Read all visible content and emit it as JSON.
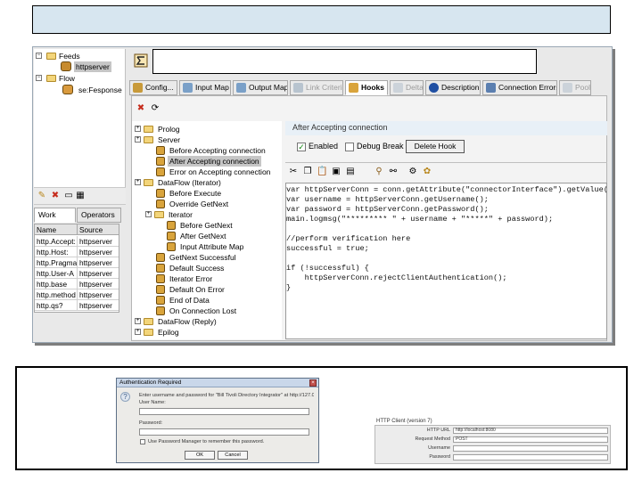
{
  "colors": {
    "title_band": "#d7e6f0",
    "selection": "#c6c6c6",
    "hook_header": "#e8f0f7"
  },
  "nav_tree": {
    "items": [
      {
        "label": "Feeds",
        "icon": "folder-icon"
      },
      {
        "label": "httpserver",
        "icon": "feed-node-icon"
      },
      {
        "label": "Flow",
        "icon": "folder-icon"
      },
      {
        "label": "se:Fesponse",
        "icon": "flow-node-icon"
      }
    ]
  },
  "side_panel": {
    "tabs": [
      "Work Entry",
      "Operators"
    ],
    "columns": [
      "Name",
      "Source"
    ],
    "rows": [
      [
        "http.Accept:",
        "httpserver"
      ],
      [
        "http.Host:",
        "httpserver"
      ],
      [
        "http.Pragma",
        "httpserver"
      ],
      [
        "http.User-A",
        "httpserver"
      ],
      [
        "http.base",
        "httpserver"
      ],
      [
        "http.method",
        "httpserver"
      ],
      [
        "http.qs?",
        "httpserver"
      ]
    ]
  },
  "tabs": [
    {
      "label": "Config...",
      "icon": "config-icon",
      "state": "normal"
    },
    {
      "label": "Input Map",
      "icon": "input-map-icon",
      "state": "normal"
    },
    {
      "label": "Output Map",
      "icon": "output-map-icon",
      "state": "normal"
    },
    {
      "label": "Link Criteria",
      "icon": "link-criteria-icon",
      "state": "dim"
    },
    {
      "label": "Hooks",
      "icon": "hooks-icon",
      "state": "active"
    },
    {
      "label": "Delta",
      "icon": "delta-icon",
      "state": "dim"
    },
    {
      "label": "Description",
      "icon": "info-icon",
      "state": "normal"
    },
    {
      "label": "Connection Errors",
      "icon": "connection-errors-icon",
      "state": "normal"
    },
    {
      "label": "Pool",
      "icon": "pool-icon",
      "state": "dim"
    }
  ],
  "hooks_tree": {
    "items": [
      {
        "label": "Prolog",
        "level": 0,
        "kind": "folder"
      },
      {
        "label": "Server",
        "level": 0,
        "kind": "folder"
      },
      {
        "label": "Before Accepting connection",
        "level": 1,
        "kind": "hook"
      },
      {
        "label": "After Accepting connection",
        "level": 1,
        "kind": "hook",
        "selected": true
      },
      {
        "label": "Error on Accepting connection",
        "level": 1,
        "kind": "hook"
      },
      {
        "label": "DataFlow (Iterator)",
        "level": 0,
        "kind": "folder"
      },
      {
        "label": "Before Execute",
        "level": 1,
        "kind": "hook"
      },
      {
        "label": "Override GetNext",
        "level": 1,
        "kind": "hook"
      },
      {
        "label": "Iterator",
        "level": 1,
        "kind": "folder"
      },
      {
        "label": "Before GetNext",
        "level": 2,
        "kind": "hook"
      },
      {
        "label": "After GetNext",
        "level": 2,
        "kind": "hook"
      },
      {
        "label": "Input Attribute Map",
        "level": 2,
        "kind": "hook"
      },
      {
        "label": "GetNext Successful",
        "level": 1,
        "kind": "hook"
      },
      {
        "label": "Default Success",
        "level": 1,
        "kind": "hook"
      },
      {
        "label": "Iterator Error",
        "level": 1,
        "kind": "hook"
      },
      {
        "label": "Default On Error",
        "level": 1,
        "kind": "hook"
      },
      {
        "label": "End of Data",
        "level": 1,
        "kind": "hook"
      },
      {
        "label": "On Connection Lost",
        "level": 1,
        "kind": "hook"
      },
      {
        "label": "DataFlow (Reply)",
        "level": 0,
        "kind": "folder"
      },
      {
        "label": "Epilog",
        "level": 0,
        "kind": "folder"
      }
    ]
  },
  "hook_panel": {
    "title": "After Accepting connection",
    "enabled_label": "Enabled",
    "debug_label": "Debug Break",
    "delete_label": "Delete Hook",
    "code": [
      "var httpServerConn = conn.getAttribute(\"connectorInterface\").getValue(0);",
      "var username = httpServerConn.getUsername();",
      "var password = httpServerConn.getPassword();",
      "main.logmsg(\"********* \" + username + \"*****\" + password);",
      "",
      "//perform verification here",
      "successful = true;",
      "",
      "if (!successful) {",
      "    httpServerConn.rejectClientAuthentication();",
      "}"
    ]
  },
  "auth_dialog": {
    "title": "Authentication Required",
    "message": "Enter username and password for \"Bill Tivoli Directory Integrator\" at http://127.0.0.1",
    "username_label": "User Name:",
    "password_label": "Password:",
    "remember_label": "Use Password Manager to remember this password.",
    "ok_label": "OK",
    "cancel_label": "Cancel"
  },
  "http_client": {
    "title": "HTTP Client (version 7)",
    "fields": [
      {
        "label": "HTTP URL",
        "value": "http://localhost:8080"
      },
      {
        "label": "Request Method",
        "value": "POST"
      },
      {
        "label": "Username",
        "value": ""
      },
      {
        "label": "Password",
        "value": ""
      }
    ]
  }
}
